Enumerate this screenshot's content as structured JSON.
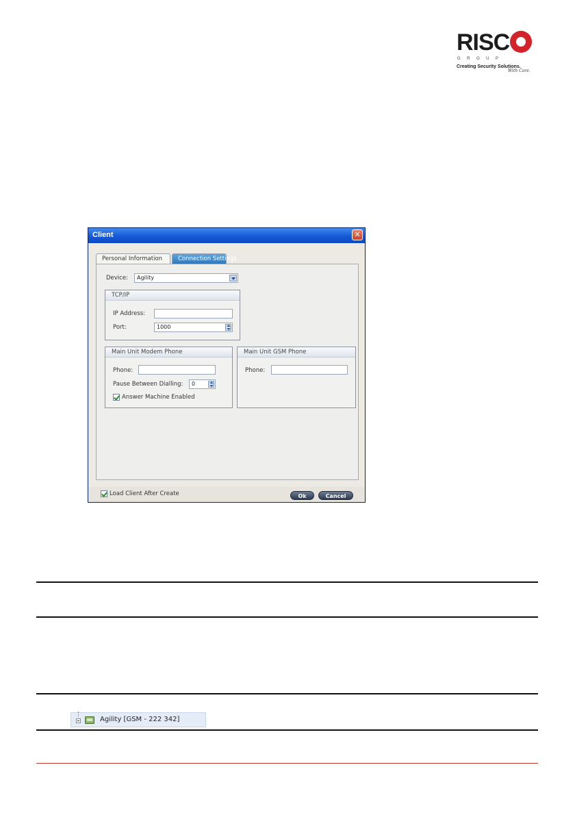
{
  "logo": {
    "word": "RISC",
    "group": "GROUP",
    "tagline": "Creating Security Solutions.",
    "script": "With Care."
  },
  "dialog": {
    "title": "Client",
    "close_glyph": "✕",
    "tabs": [
      {
        "label": "Personal Information",
        "selected": false
      },
      {
        "label": "Connection Settings",
        "selected": true
      }
    ],
    "device": {
      "label": "Device:",
      "value": "Agility"
    },
    "tcpip": {
      "title": "TCP/IP",
      "ip_label": "IP Address:",
      "ip_value": "",
      "port_label": "Port:",
      "port_value": "1000"
    },
    "modem": {
      "title": "Main Unit Modem Phone",
      "phone_label": "Phone:",
      "phone_value": "",
      "pause_label": "Pause Between Dialling:",
      "pause_value": "0",
      "answer_label": "Answer Machine Enabled",
      "answer_checked": true
    },
    "gsm": {
      "title": "Main Unit GSM Phone",
      "phone_label": "Phone:",
      "phone_value": ""
    },
    "footer": {
      "load_label": "Load Client After Create",
      "load_checked": true,
      "ok_label": "Ok",
      "cancel_label": "Cancel"
    }
  },
  "tree_item": {
    "label": "Agility [GSM - 222 342]"
  }
}
